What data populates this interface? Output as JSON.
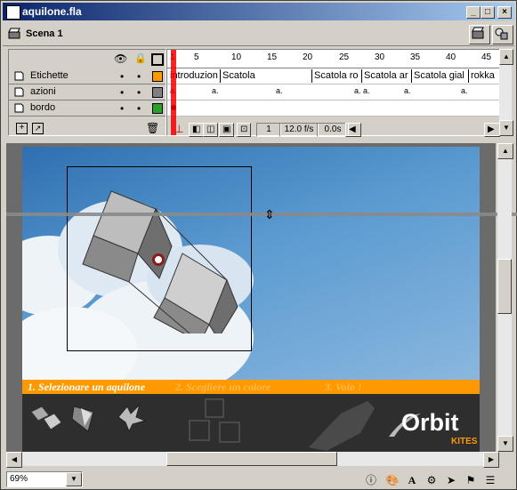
{
  "window": {
    "title": "aquilone.fla",
    "min": "_",
    "max": "□",
    "close": "×"
  },
  "scene": {
    "label": "Scena 1"
  },
  "layers": [
    {
      "name": "Etichette",
      "color": "#ff9900"
    },
    {
      "name": "azioni",
      "color": "#808080"
    },
    {
      "name": "bordo",
      "color": "#2aa02a"
    }
  ],
  "ruler": [
    "1",
    "5",
    "10",
    "15",
    "20",
    "25",
    "30",
    "35",
    "40",
    "45"
  ],
  "frame_labels": [
    "introduzion",
    "Scatola",
    "Scatola ro",
    "Scatola ar",
    "Scatola gial",
    "rokka"
  ],
  "action_marks": [
    "a.",
    "a.",
    "a.",
    "a.",
    "a.",
    "a.",
    "a."
  ],
  "frame_status": {
    "current_frame": "1",
    "fps": "12.0 f/s",
    "time": "0.0s"
  },
  "stage_menu": {
    "item1": "1. Selezionare un aquilone",
    "item2": "2. Scegliere un colore",
    "item3": "3. Volo !"
  },
  "brand": {
    "name": "Orbit",
    "sub": "KITES"
  },
  "zoom": {
    "value": "69%"
  }
}
